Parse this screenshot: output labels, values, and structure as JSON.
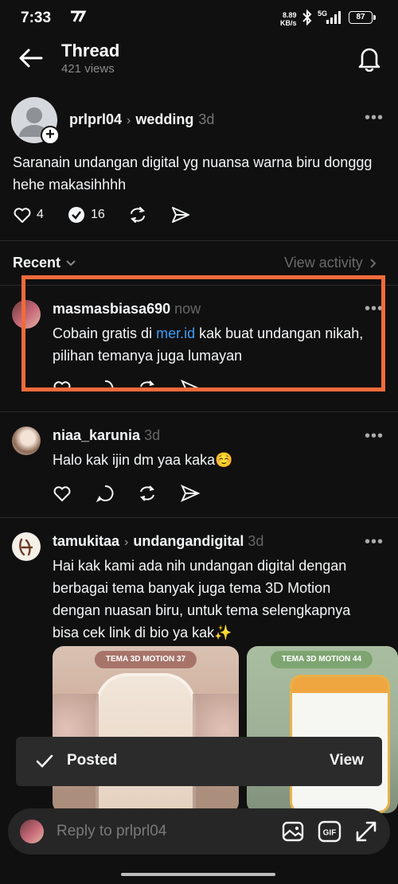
{
  "status_bar": {
    "time": "7:33",
    "speed_value": "8.89",
    "speed_unit": "KB/s",
    "network": "5G",
    "battery": "87"
  },
  "header": {
    "title": "Thread",
    "views": "421 views"
  },
  "post": {
    "username": "prlprl04",
    "topic": "wedding",
    "time": "3d",
    "text": "Saranain undangan digital yg nuansa warna biru donggg hehe makasihhhh",
    "likes": "4",
    "replies": "16"
  },
  "sort": {
    "label": "Recent",
    "view_activity": "View activity"
  },
  "replies": [
    {
      "username": "masmasbiasa690",
      "time": "now",
      "text_before": "Cobain gratis di ",
      "link": "mer.id",
      "text_after": " kak buat undangan nikah, pilihan temanya juga lumayan"
    },
    {
      "username": "niaa_karunia",
      "time": "3d",
      "text": "Halo kak ijin dm yaa kaka☺️"
    },
    {
      "username": "tamukitaa",
      "topic": "undangandigital",
      "time": "3d",
      "text": "Hai kak kami ada nih undangan digital dengan berbagai tema banyak juga tema 3D Motion dengan nuasan biru, untuk tema selengkapnya bisa cek link di bio ya kak✨",
      "cards": [
        {
          "label": "TEMA 3D MOTION 37",
          "badge_color": "#a7746a"
        },
        {
          "label": "TEMA 3D MOTION 44",
          "badge_color": "#7ea571"
        }
      ]
    }
  ],
  "toast": {
    "text": "Posted",
    "action": "View"
  },
  "reply_bar": {
    "placeholder": "Reply to prlprl04"
  },
  "colors": {
    "background": "#101010",
    "highlight": "#f26b3a",
    "link": "#3f9cf5"
  },
  "icons": [
    "back-arrow-icon",
    "bell-icon",
    "heart-icon",
    "comment-icon",
    "repost-icon",
    "share-icon",
    "image-icon",
    "gif-icon",
    "expand-icon",
    "check-icon",
    "more-icon",
    "chevron-down-icon",
    "chevron-right-icon"
  ]
}
